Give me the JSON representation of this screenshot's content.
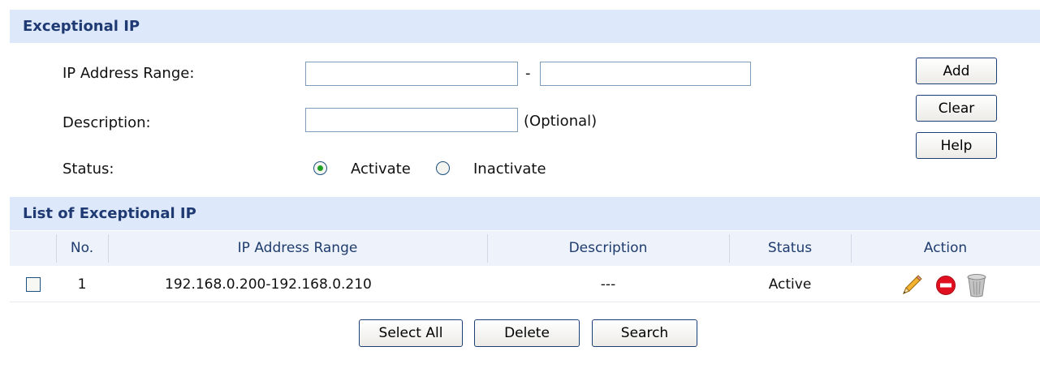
{
  "exceptional_ip": {
    "title": "Exceptional IP",
    "ip_range_label": "IP Address Range:",
    "ip_start_value": "",
    "range_separator": "-",
    "ip_end_value": "",
    "description_label": "Description:",
    "description_value": "",
    "optional_hint": "(Optional)",
    "status_label": "Status:",
    "status_options": [
      {
        "label": "Activate",
        "checked": true
      },
      {
        "label": "Inactivate",
        "checked": false
      }
    ],
    "buttons": {
      "add": "Add",
      "clear": "Clear",
      "help": "Help"
    }
  },
  "list": {
    "title": "List of Exceptional IP",
    "columns": [
      "No.",
      "IP Address Range",
      "Description",
      "Status",
      "Action"
    ],
    "rows": [
      {
        "no": "1",
        "range": "192.168.0.200-192.168.0.210",
        "description": "---",
        "status": "Active",
        "actions": [
          "edit-pencil-icon",
          "disable-icon",
          "trash-icon"
        ]
      }
    ],
    "buttons": {
      "select_all": "Select All",
      "delete": "Delete",
      "search": "Search"
    }
  },
  "colors": {
    "header_bg": "#dde8fa",
    "header_text": "#1f3a73",
    "button_border": "#1c3f7a",
    "radio_checked": "#21a121",
    "disable_icon": "#e01020"
  }
}
